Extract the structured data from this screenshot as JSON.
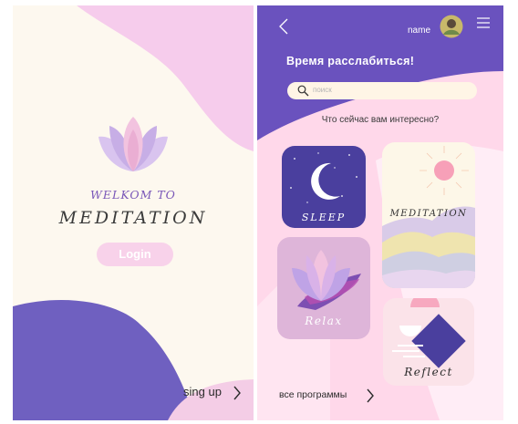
{
  "welcome": {
    "greeting": "WELKOM TO",
    "title": "MEDITATION",
    "login_label": "Login",
    "signup_label": "sing up"
  },
  "home": {
    "username": "name",
    "headline": "Время расслабиться!",
    "search_placeholder": "поиск",
    "question": "Что сейчас вам интересно?",
    "cards": [
      {
        "label": "SLEEP"
      },
      {
        "label": "MEDITATION"
      },
      {
        "label": "Relax"
      },
      {
        "label": "Reflect"
      }
    ],
    "all_programs_label": "все программы"
  },
  "icons": [
    "lotus-icon",
    "chevron-right-icon",
    "back-arrow-icon",
    "menu-icon",
    "search-icon",
    "moon-icon"
  ],
  "colors": {
    "purple": "#6a52be",
    "lavender": "#e3b7dd",
    "pink": "#ffd8ea",
    "cream": "#fdf8ef",
    "sleep_card": "#4a3f9e",
    "accent_pink": "#f0a3c8"
  }
}
